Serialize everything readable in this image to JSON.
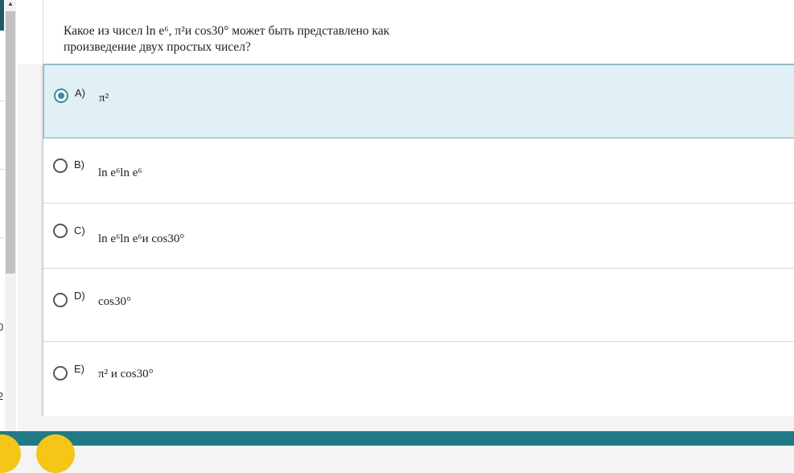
{
  "question": "Какое из чисел ln e⁶, π²и cos30° может быть представлено как произведение двух простых чисел?",
  "options": [
    {
      "letter": "A)",
      "text": "π²",
      "selected": true
    },
    {
      "letter": "B)",
      "text": "ln e⁶ln e⁶",
      "selected": false
    },
    {
      "letter": "C)",
      "text": "ln e⁶ln e⁶и cos30°",
      "selected": false
    },
    {
      "letter": "D)",
      "text": "cos30°",
      "selected": false
    },
    {
      "letter": "E)",
      "text": "π² и cos30°",
      "selected": false
    }
  ],
  "edge_numbers": [
    "0",
    "2"
  ],
  "colors": {
    "accent": "#1f7a86",
    "selected_bg": "#e0f0f4",
    "radio": "#3a8ba3",
    "badge": "#f5c518"
  }
}
